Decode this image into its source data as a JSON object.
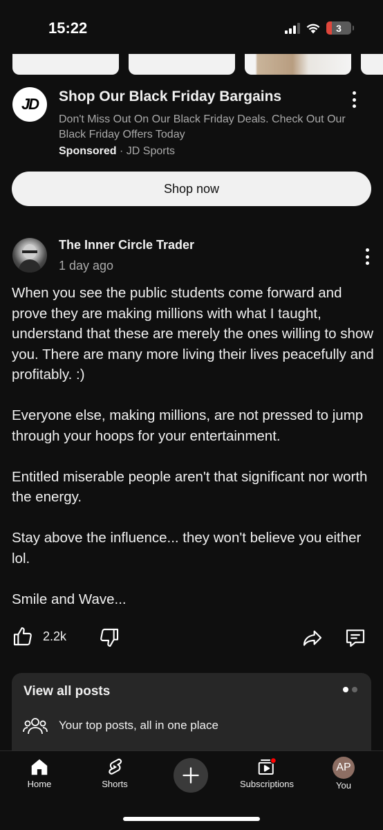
{
  "status_bar": {
    "time": "15:22",
    "battery_level": "3"
  },
  "ad": {
    "logo_text": "JD",
    "title": "Shop Our Black Friday Bargains",
    "description": "Don't Miss Out On Our Black Friday Deals. Check Out Our Black Friday Offers Today",
    "sponsored_label": "Sponsored",
    "separator": "·",
    "advertiser": "JD Sports",
    "cta_label": "Shop now"
  },
  "post": {
    "author": "The Inner Circle Trader",
    "time": "1 day ago",
    "paragraphs": [
      "When you see the public students come forward and prove they are making millions with what I taught, understand that these are merely the ones willing to show you.  There are many more living their lives peacefully and profitably.  :)",
      "Everyone else, making millions, are not pressed to jump through your hoops for your entertainment.",
      "Entitled miserable people aren't that significant nor worth the energy.",
      "Stay above the influence... they won't believe you either lol.",
      "Smile and Wave..."
    ],
    "like_count": "2.2k"
  },
  "view_all_posts": {
    "title": "View all posts",
    "subtitle": "Your top posts, all in one place"
  },
  "bottom_nav": {
    "home": "Home",
    "shorts": "Shorts",
    "subscriptions": "Subscriptions",
    "you": "You",
    "you_initials": "AP"
  },
  "colors": {
    "background": "#0f0f0f",
    "card": "#272727",
    "text_primary": "#f1f1f1",
    "text_secondary": "#aaaaaa",
    "notification_dot": "#ff0000"
  }
}
